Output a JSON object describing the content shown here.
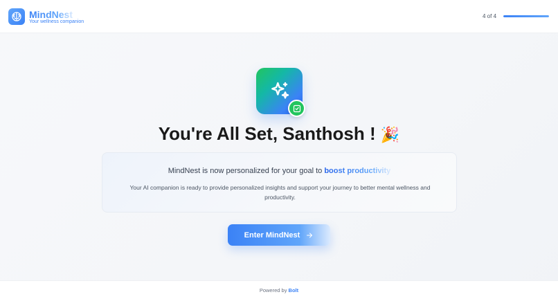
{
  "header": {
    "brand_name": "MindNest",
    "tagline": "Your wellness companion",
    "step": "4 of 4",
    "progress": 1.0
  },
  "hero": {
    "icon": "sparkles-icon",
    "badge_icon": "check-square-icon"
  },
  "title": {
    "text": "You're All Set, Santhosh !",
    "emoji": "🎉"
  },
  "card": {
    "line1_prefix": "MindNest is now personalized for your goal to",
    "goal": "boost productivity",
    "line2": "Your AI companion is ready to provide personalized insights and support your journey to better mental wellness and productivity."
  },
  "cta": {
    "label": "Enter MindNest",
    "icon": "arrow-right-icon"
  },
  "footer": {
    "prefix": "Powered by",
    "brand": "Bolt"
  },
  "colors": {
    "accent": "#3b82f6",
    "success": "#22c55e"
  }
}
